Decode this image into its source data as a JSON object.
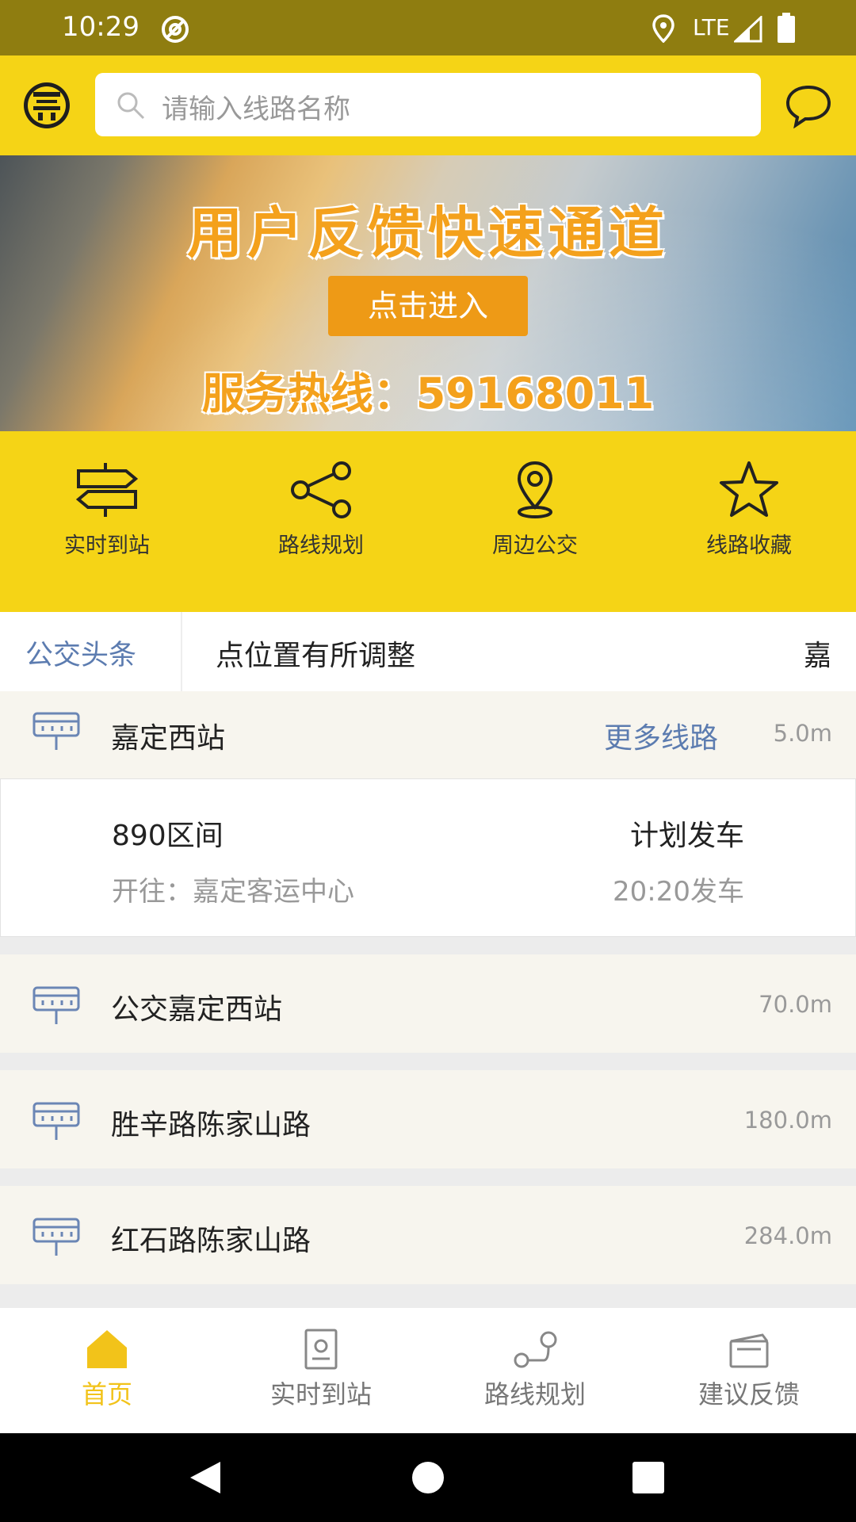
{
  "status_bar": {
    "time": "10:29",
    "network": "LTE"
  },
  "header": {
    "search_placeholder": "请输入线路名称"
  },
  "banner": {
    "title": "用户反馈快速通道",
    "button_label": "点击进入",
    "hotline": "服务热线：59168011"
  },
  "quick_menu": [
    {
      "label": "实时到站",
      "icon": "signpost-icon"
    },
    {
      "label": "路线规划",
      "icon": "share-route-icon"
    },
    {
      "label": "周边公交",
      "icon": "location-pin-icon"
    },
    {
      "label": "线路收藏",
      "icon": "star-icon"
    }
  ],
  "headline": {
    "tag": "公交头条",
    "text": "点位置有所调整",
    "text_tail": "嘉"
  },
  "nearby": {
    "main_station": {
      "name": "嘉定西站",
      "more_label": "更多线路",
      "distance": "5.0m"
    },
    "bus": {
      "line": "890区间",
      "destination": "开往：嘉定客运中心",
      "status": "计划发车",
      "time": "20:20发车"
    },
    "stations": [
      {
        "name": "公交嘉定西站",
        "distance": "70.0m"
      },
      {
        "name": "胜辛路陈家山路",
        "distance": "180.0m"
      },
      {
        "name": "红石路陈家山路",
        "distance": "284.0m"
      }
    ]
  },
  "bottom_nav": [
    {
      "label": "首页",
      "icon": "home-icon",
      "active": true
    },
    {
      "label": "实时到站",
      "icon": "realtime-icon",
      "active": false
    },
    {
      "label": "路线规划",
      "icon": "route-plan-icon",
      "active": false
    },
    {
      "label": "建议反馈",
      "icon": "feedback-icon",
      "active": false
    }
  ],
  "colors": {
    "brand_yellow": "#F5D416",
    "status_bar": "#8F7D10",
    "accent_blue": "#5C7CB0",
    "active_nav": "#F2C31A"
  }
}
